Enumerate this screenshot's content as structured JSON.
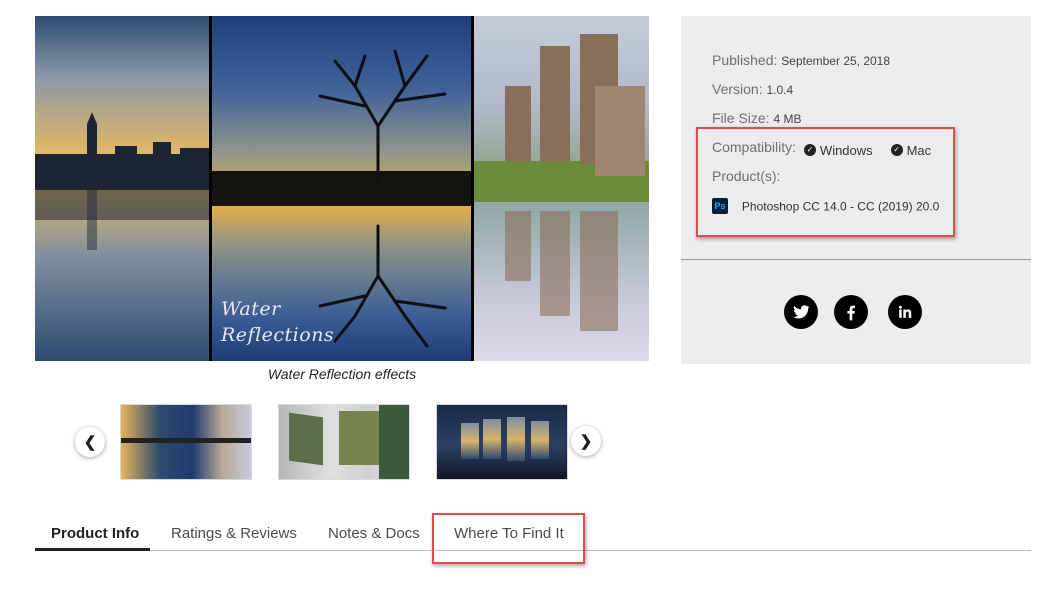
{
  "hero": {
    "overlay_text_line1": "Water",
    "overlay_text_line2": "Reflections",
    "caption": "Water Reflection effects"
  },
  "carousel": {
    "prev_icon": "chevron-left-icon",
    "next_icon": "chevron-right-icon"
  },
  "info": {
    "published_label": "Published:",
    "published_value": "September 25, 2018",
    "version_label": "Version:",
    "version_value": "1.0.4",
    "filesize_label": "File Size:",
    "filesize_value": "4 MB",
    "compatibility_label": "Compatibility:",
    "compat_windows": "Windows",
    "compat_mac": "Mac",
    "products_label": "Product(s):",
    "product_icon_text": "Ps",
    "product_name": "Photoshop CC 14.0 - CC (2019) 20.0"
  },
  "social": [
    "twitter-icon",
    "facebook-icon",
    "linkedin-icon"
  ],
  "tabs": [
    {
      "label": "Product Info",
      "active": true
    },
    {
      "label": "Ratings & Reviews",
      "active": false
    },
    {
      "label": "Notes & Docs",
      "active": false
    },
    {
      "label": "Where To Find It",
      "active": false
    }
  ],
  "colors": {
    "highlight": "#e04b4b",
    "info_bg": "#ececec",
    "active_tab": "#222222"
  }
}
